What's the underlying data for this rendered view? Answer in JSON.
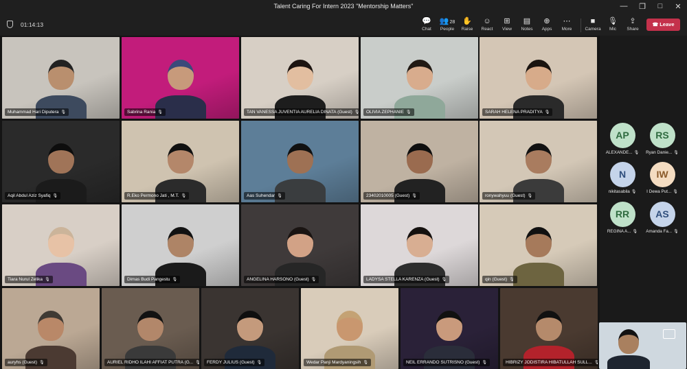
{
  "window": {
    "title": "Talent Caring For Intern 2023 \"Mentorship Matters\"",
    "controls": [
      "—",
      "❐",
      "□",
      "✕"
    ]
  },
  "meeting": {
    "timer": "01:14:13"
  },
  "toolbar": {
    "chat": "Chat",
    "people": "People",
    "people_count": "28",
    "raise": "Raise",
    "react": "React",
    "view": "View",
    "notes": "Notes",
    "apps": "Apps",
    "more": "More",
    "camera": "Camera",
    "mic": "Mic",
    "share": "Share",
    "leave": "Leave"
  },
  "tiles": [
    {
      "name": "Muhammad Hari Diputera",
      "bg": "#c8c4bd",
      "skin": "#b98f6e",
      "shirt": "#3d4a5e",
      "hair": "#222"
    },
    {
      "name": "Sabrina Rania",
      "bg": "#c21c7b",
      "skin": "#c79a7b",
      "shirt": "#2a2e4a",
      "hair": "#3a4a7a"
    },
    {
      "name": "TAN VANESSA JUVENTIA AURELIA DINATA (Guest)",
      "bg": "#d7cfc5",
      "skin": "#e2bea0",
      "shirt": "#1d1d1d",
      "hair": "#1c1410"
    },
    {
      "name": "OLIVIA ZEPHANIE",
      "bg": "#c9cdca",
      "skin": "#d8ac8d",
      "shirt": "#8fa89a",
      "hair": "#221a14"
    },
    {
      "name": "SARAH HELENA PRADITYA",
      "bg": "#d4c6b5",
      "skin": "#d7ab8a",
      "shirt": "#2a2a2a",
      "hair": "#1a1410"
    },
    {
      "name": "Aqil Abdul Aziz Syafiq",
      "bg": "#2a2a2a",
      "skin": "#a07458",
      "shirt": "#1b1b1b",
      "hair": "#0d0d0d"
    },
    {
      "name": "R.Eko Permono Jati , M.T.",
      "bg": "#cfc3b0",
      "skin": "#b4876a",
      "shirt": "#2b2b2b",
      "hair": "#111"
    },
    {
      "name": "Aas Suhendar",
      "bg": "#5d7e98",
      "skin": "#9e7154",
      "shirt": "#3a3d3f",
      "hair": "#111"
    },
    {
      "name": "23402010005 (Guest)",
      "bg": "#bfb2a2",
      "skin": "#9a6b4f",
      "shirt": "#222",
      "hair": "#0f0f0f"
    },
    {
      "name": "ronywahyuu (Guest)",
      "bg": "#d3c7b6",
      "skin": "#a97c5f",
      "shirt": "#3b3b3b",
      "hair": "#121212"
    },
    {
      "name": "Tiara Nurul Zelika",
      "bg": "#d8cfc6",
      "skin": "#e7c2a6",
      "shirt": "#6a4a82",
      "hair": "#cbb49a"
    },
    {
      "name": "Dimas Budi Pangestu",
      "bg": "#cfcfcf",
      "skin": "#ae8466",
      "shirt": "#1a1a1a",
      "hair": "#121212"
    },
    {
      "name": "ANGELINA HARSONO (Guest)",
      "bg": "#3f3a3a",
      "skin": "#d2a286",
      "shirt": "#262626",
      "hair": "#1a1412"
    },
    {
      "name": "LADYSA STELLA KARENZA (Guest)",
      "bg": "#ddd8d9",
      "skin": "#d8ae92",
      "shirt": "#2d2d2d",
      "hair": "#15110f"
    },
    {
      "name": "qin (Guest)",
      "bg": "#d6cab8",
      "skin": "#a67a5b",
      "shirt": "#6d6440",
      "hair": "#111"
    },
    {
      "name": "auryhs (Guest)",
      "bg": "#bba894",
      "skin": "#b98868",
      "shirt": "#4b3a32",
      "hair": "#3f3a34"
    },
    {
      "name": "AURIEL RIDHO ILAHI AFFIAT PUTRA (G...",
      "bg": "#6a5c50",
      "skin": "#b2876a",
      "shirt": "#3a3a3a",
      "hair": "#121212"
    },
    {
      "name": "FERDY JULIUS (Guest)",
      "bg": "#3a3431",
      "skin": "#c49a7c",
      "shirt": "#1f2a3a",
      "hair": "#0f0f0f"
    },
    {
      "name": "Wedar Panji Mardyaningsih",
      "bg": "#d9ccba",
      "skin": "#c9976f",
      "shirt": "#b09a74",
      "hair": "#c4a274"
    },
    {
      "name": "NEIL ERRANDO SUTRISNO (Guest)",
      "bg": "#2a2138",
      "skin": "#c99a7c",
      "shirt": "#2a2d3a",
      "hair": "#111"
    },
    {
      "name": "HIBRIZY JODISTIRA HIBATULLAH SULL...",
      "bg": "#4a3a30",
      "skin": "#b58a6b",
      "shirt": "#b3222b",
      "hair": "#111"
    }
  ],
  "side_participants": [
    {
      "initials": "AP",
      "name": "ALEXANDE...",
      "color": "#bfe1c9",
      "text": "#2e6a3f"
    },
    {
      "initials": "RS",
      "name": "Ryan Danie...",
      "color": "#bfe1c9",
      "text": "#2e6a3f"
    },
    {
      "initials": "N",
      "name": "nikitasabila",
      "color": "#c5d4ea",
      "text": "#2f4e7c"
    },
    {
      "initials": "IW",
      "name": "I Dewa Put...",
      "color": "#f4dcc1",
      "text": "#8a5a2a"
    },
    {
      "initials": "RR",
      "name": "REGINA A...",
      "color": "#bfe1c9",
      "text": "#2e6a3f"
    },
    {
      "initials": "AS",
      "name": "Amanda Fa...",
      "color": "#c5d4ea",
      "text": "#2f4e7c"
    }
  ],
  "self_view": {
    "bg": "#cfd8df",
    "skin": "#a9805f",
    "shirt": "#1e2530",
    "hair": "#121212"
  },
  "icons": {
    "mic": "🎙",
    "shield": "shield-icon"
  }
}
